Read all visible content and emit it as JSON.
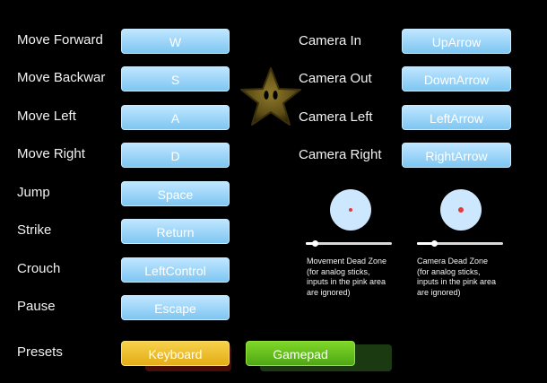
{
  "left_bindings": [
    {
      "label": "Move Forward",
      "key": "W"
    },
    {
      "label": "Move Backwar",
      "key": "S"
    },
    {
      "label": "Move Left",
      "key": "A"
    },
    {
      "label": "Move Right",
      "key": "D"
    },
    {
      "label": "Jump",
      "key": "Space"
    },
    {
      "label": "Strike",
      "key": "Return"
    },
    {
      "label": "Crouch",
      "key": "LeftControl"
    },
    {
      "label": "Pause",
      "key": "Escape"
    }
  ],
  "right_bindings": [
    {
      "label": "Camera In",
      "key": "UpArrow"
    },
    {
      "label": "Camera Out",
      "key": "DownArrow"
    },
    {
      "label": "Camera Left",
      "key": "LeftArrow"
    },
    {
      "label": "Camera Right",
      "key": "RightArrow"
    }
  ],
  "dead_zones": {
    "movement": {
      "text": "Movement Dead Zone (for analog sticks, inputs in the pink area are ignored)",
      "value": 0.1
    },
    "camera": {
      "text": "Camera Dead Zone (for analog sticks, inputs in the pink area are ignored)",
      "value": 0.2
    }
  },
  "presets": {
    "label": "Presets",
    "keyboard": "Keyboard",
    "gamepad": "Gamepad"
  },
  "colors": {
    "key_button": "#8fd0f5",
    "keyboard_preset": "#f2c230",
    "gamepad_preset": "#6cc31e",
    "background": "#000000"
  },
  "icons": [
    "star-icon"
  ]
}
